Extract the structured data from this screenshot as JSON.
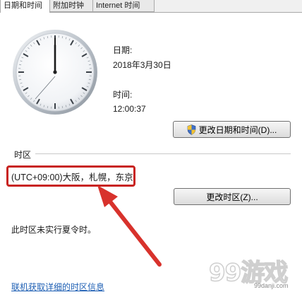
{
  "tabs": [
    {
      "label": "日期和时间",
      "active": true
    },
    {
      "label": "附加时钟",
      "active": false
    },
    {
      "label": "Internet 时间",
      "active": false
    }
  ],
  "clock": {
    "time": "12:00:37"
  },
  "date_section": {
    "label": "日期:",
    "value": "2018年3月30日"
  },
  "time_section": {
    "label": "时间:",
    "value": "12:00:37"
  },
  "buttons": {
    "change_datetime": "更改日期和时间(D)...",
    "change_timezone": "更改时区(Z)..."
  },
  "timezone": {
    "group_label": "时区",
    "value": "(UTC+09:00)大阪，札幌，东京",
    "dst_note": "此时区未实行夏令时。"
  },
  "link": {
    "label": "联机获取详细的时区信息"
  },
  "watermark": {
    "brand": "99游戏",
    "url": "99danji.com"
  },
  "colors": {
    "highlight": "#c8231f",
    "link": "#1e5fb4"
  }
}
